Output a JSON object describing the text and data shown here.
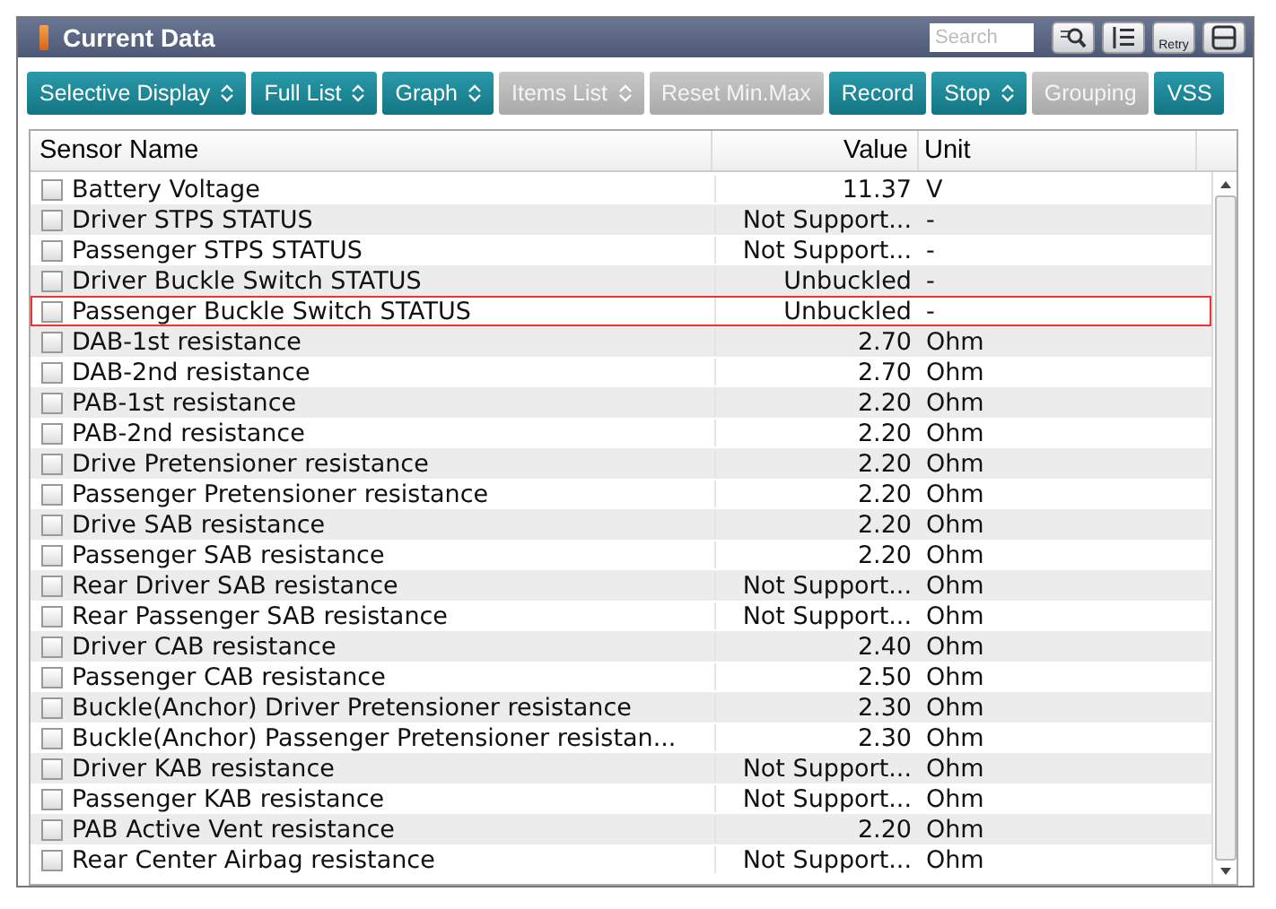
{
  "window": {
    "title": "Current Data"
  },
  "search": {
    "placeholder": "Search"
  },
  "title_buttons": [
    {
      "kind": "find"
    },
    {
      "kind": "list"
    },
    {
      "kind": "retry",
      "label": "Retry"
    },
    {
      "kind": "layout"
    }
  ],
  "toolbar": [
    {
      "label": "Selective Display",
      "dropdown": true,
      "disabled": false
    },
    {
      "label": "Full List",
      "dropdown": true,
      "disabled": false
    },
    {
      "label": "Graph",
      "dropdown": true,
      "disabled": false
    },
    {
      "label": "Items List",
      "dropdown": true,
      "disabled": true
    },
    {
      "label": "Reset Min.Max",
      "dropdown": false,
      "disabled": true
    },
    {
      "label": "Record",
      "dropdown": false,
      "disabled": false
    },
    {
      "label": "Stop",
      "dropdown": true,
      "disabled": false
    },
    {
      "label": "Grouping",
      "dropdown": false,
      "disabled": true
    },
    {
      "label": "VSS",
      "dropdown": false,
      "disabled": false
    }
  ],
  "table": {
    "columns": [
      "Sensor Name",
      "Value",
      "Unit"
    ],
    "rows": [
      {
        "name": "Battery Voltage",
        "value": "11.37",
        "unit": "V",
        "checked": false,
        "selected": false
      },
      {
        "name": "Driver STPS STATUS",
        "value": "Not Support...",
        "unit": "-",
        "checked": false,
        "selected": false
      },
      {
        "name": "Passenger STPS STATUS",
        "value": "Not Support...",
        "unit": "-",
        "checked": false,
        "selected": false
      },
      {
        "name": "Driver Buckle Switch STATUS",
        "value": "Unbuckled",
        "unit": "-",
        "checked": false,
        "selected": false
      },
      {
        "name": "Passenger Buckle Switch STATUS",
        "value": "Unbuckled",
        "unit": "-",
        "checked": false,
        "selected": true
      },
      {
        "name": "DAB-1st resistance",
        "value": "2.70",
        "unit": "Ohm",
        "checked": false,
        "selected": false
      },
      {
        "name": "DAB-2nd resistance",
        "value": "2.70",
        "unit": "Ohm",
        "checked": false,
        "selected": false
      },
      {
        "name": "PAB-1st resistance",
        "value": "2.20",
        "unit": "Ohm",
        "checked": false,
        "selected": false
      },
      {
        "name": "PAB-2nd resistance",
        "value": "2.20",
        "unit": "Ohm",
        "checked": false,
        "selected": false
      },
      {
        "name": "Drive Pretensioner resistance",
        "value": "2.20",
        "unit": "Ohm",
        "checked": false,
        "selected": false
      },
      {
        "name": "Passenger Pretensioner resistance",
        "value": "2.20",
        "unit": "Ohm",
        "checked": false,
        "selected": false
      },
      {
        "name": "Drive SAB resistance",
        "value": "2.20",
        "unit": "Ohm",
        "checked": false,
        "selected": false
      },
      {
        "name": "Passenger SAB resistance",
        "value": "2.20",
        "unit": "Ohm",
        "checked": false,
        "selected": false
      },
      {
        "name": "Rear Driver SAB resistance",
        "value": "Not Support...",
        "unit": "Ohm",
        "checked": false,
        "selected": false
      },
      {
        "name": "Rear Passenger SAB resistance",
        "value": "Not Support...",
        "unit": "Ohm",
        "checked": false,
        "selected": false
      },
      {
        "name": "Driver CAB resistance",
        "value": "2.40",
        "unit": "Ohm",
        "checked": false,
        "selected": false
      },
      {
        "name": "Passenger CAB resistance",
        "value": "2.50",
        "unit": "Ohm",
        "checked": false,
        "selected": false
      },
      {
        "name": "Buckle(Anchor) Driver Pretensioner resistance",
        "value": "2.30",
        "unit": "Ohm",
        "checked": false,
        "selected": false
      },
      {
        "name": "Buckle(Anchor) Passenger Pretensioner resistan...",
        "value": "2.30",
        "unit": "Ohm",
        "checked": false,
        "selected": false
      },
      {
        "name": "Driver KAB resistance",
        "value": "Not Support...",
        "unit": "Ohm",
        "checked": false,
        "selected": false
      },
      {
        "name": "Passenger KAB resistance",
        "value": "Not Support...",
        "unit": "Ohm",
        "checked": false,
        "selected": false
      },
      {
        "name": "PAB Active Vent resistance",
        "value": "2.20",
        "unit": "Ohm",
        "checked": false,
        "selected": false
      },
      {
        "name": "Rear Center Airbag resistance",
        "value": "Not Support...",
        "unit": "Ohm",
        "checked": false,
        "selected": false
      }
    ]
  }
}
